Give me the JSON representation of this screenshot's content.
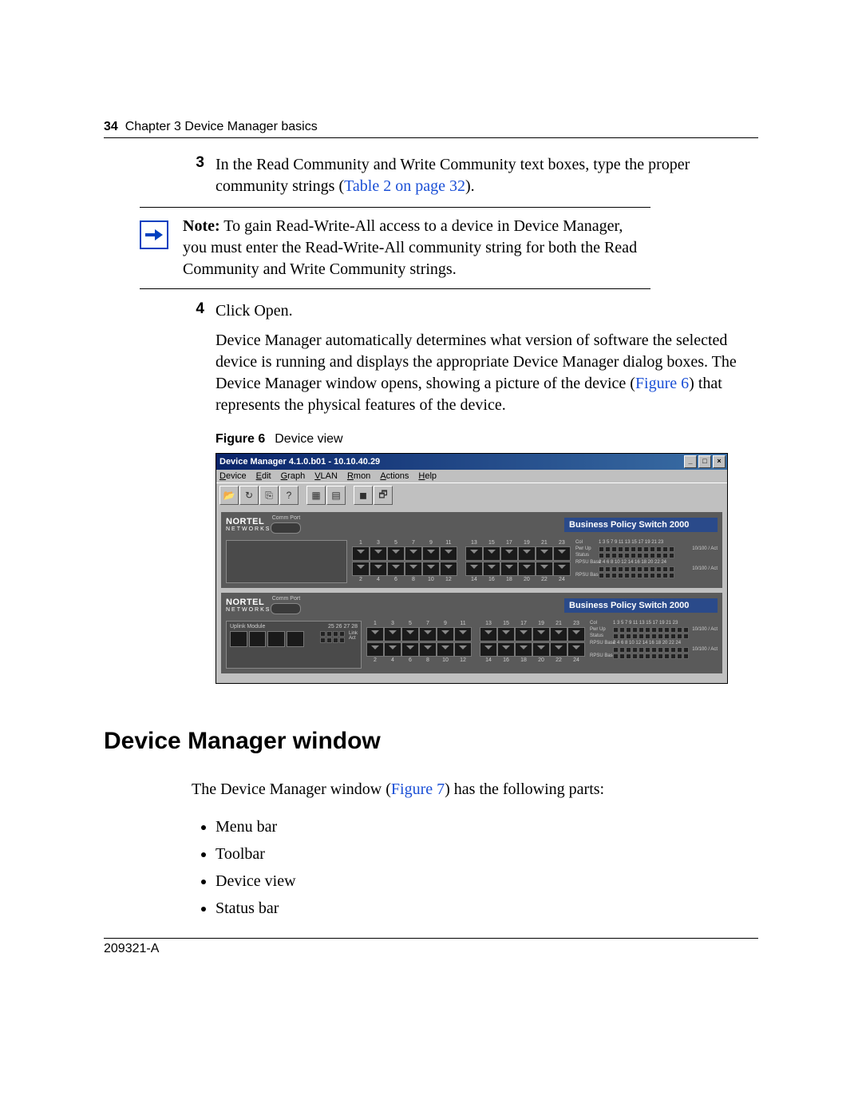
{
  "header": {
    "page": "34",
    "chapter": "Chapter 3  Device Manager basics"
  },
  "step3": {
    "num": "3",
    "text_a": "In the Read Community and Write Community text boxes, type the proper community strings (",
    "link": "Table 2 on page 32",
    "text_b": ")."
  },
  "note": {
    "label": "Note:",
    "text": " To gain Read-Write-All access to a device in Device Manager, you must enter the Read-Write-All community string for both the Read Community and Write Community strings."
  },
  "step4": {
    "num": "4",
    "line1": "Click Open.",
    "para_a": "Device Manager automatically determines what version of software the selected device is running and displays the appropriate Device Manager dialog boxes. The Device Manager window opens, showing a picture of the device (",
    "para_link": "Figure 6",
    "para_b": ") that represents the physical features of the device."
  },
  "figure": {
    "label": "Figure 6",
    "caption": "Device view"
  },
  "dm": {
    "title": "Device Manager 4.1.0.b01 - 10.10.40.29",
    "ctrls": {
      "min": "_",
      "max": "□",
      "close": "×"
    },
    "menu": [
      "Device",
      "Edit",
      "Graph",
      "VLAN",
      "Rmon",
      "Actions",
      "Help"
    ],
    "brand": "NORTEL",
    "brand_sub": "NETWORKS",
    "comm": "Comm Port",
    "model": "Business Policy Switch 2000",
    "uplink_label": "Uplink Module",
    "uplink_nums": "25 26 27 28",
    "status": {
      "col": "Col",
      "labels": [
        "Pwr   Up",
        "Status",
        "RPSU Base",
        "",
        "RPSU Base"
      ],
      "nums_top": "1 3 5 7 9 11 13 15 17 19 21 23",
      "nums_bot": "2 4 6 8 10 12 14 16 18 20 22 24",
      "speed": "10/100 / Act"
    },
    "top_nums": [
      "1",
      "3",
      "5",
      "7",
      "9",
      "11",
      "",
      "13",
      "15",
      "17",
      "19",
      "21",
      "23"
    ],
    "bot_nums": [
      "2",
      "4",
      "6",
      "8",
      "10",
      "12",
      "",
      "14",
      "16",
      "18",
      "20",
      "22",
      "24"
    ]
  },
  "section": "Device Manager window",
  "section_para_a": "The Device Manager window (",
  "section_link": "Figure 7",
  "section_para_b": ") has the following parts:",
  "parts": [
    "Menu bar",
    "Toolbar",
    "Device view",
    "Status bar"
  ],
  "footer": "209321-A"
}
